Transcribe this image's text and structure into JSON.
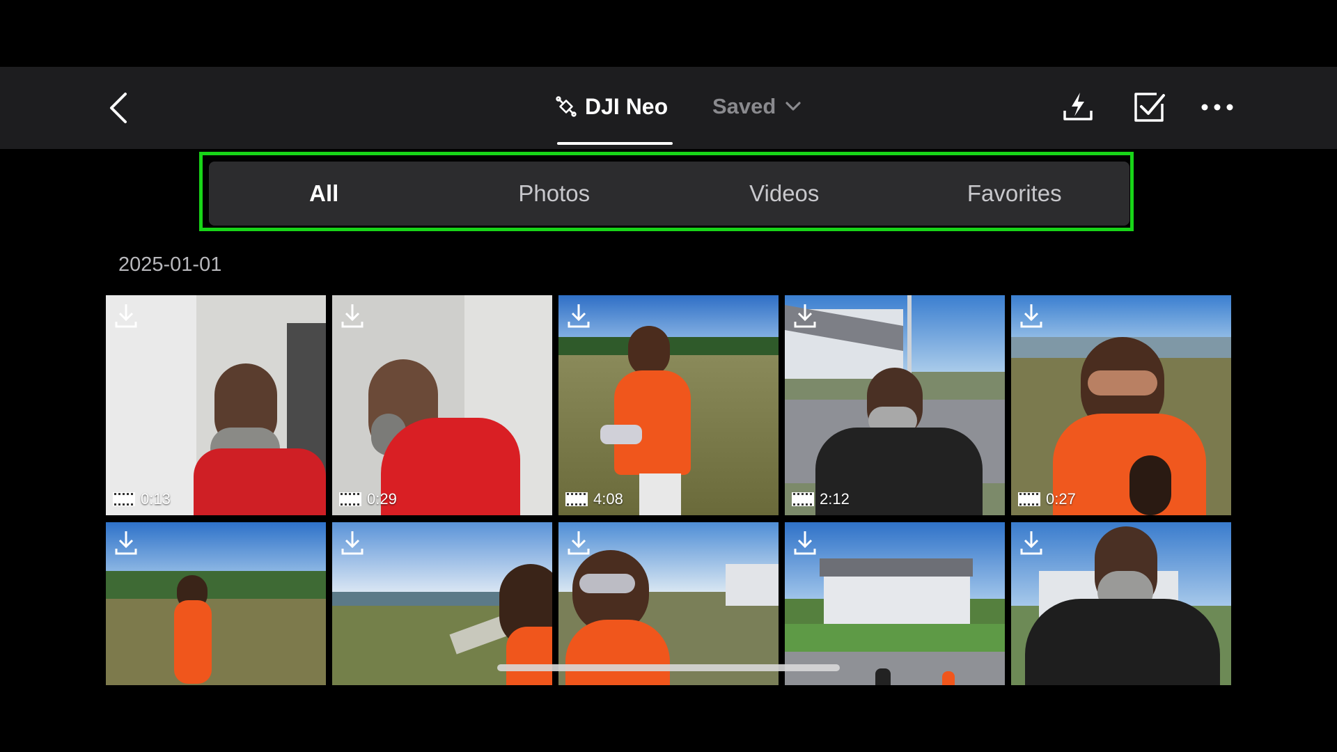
{
  "header": {
    "source_tab": "DJI Neo",
    "saved_tab": "Saved"
  },
  "filters": [
    "All",
    "Photos",
    "Videos",
    "Favorites"
  ],
  "active_filter": "All",
  "date_group": "2025-01-01",
  "thumbnails": [
    {
      "duration": "0:13"
    },
    {
      "duration": "0:29"
    },
    {
      "duration": "4:08"
    },
    {
      "duration": "2:12"
    },
    {
      "duration": "0:27"
    },
    {
      "duration": ""
    },
    {
      "duration": ""
    },
    {
      "duration": ""
    },
    {
      "duration": ""
    },
    {
      "duration": ""
    }
  ],
  "colors": {
    "accent_highlight": "#18d418",
    "bar_bg": "#1d1d1f",
    "tab_bg": "#2c2c2e"
  }
}
